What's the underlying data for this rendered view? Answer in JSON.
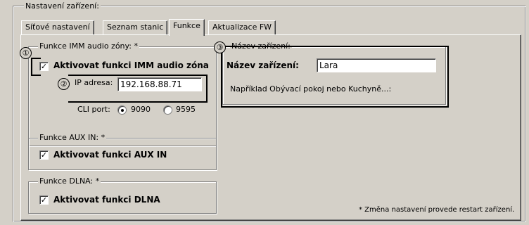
{
  "window": {
    "group_title": "Nastavení zařízení:"
  },
  "tabs": [
    {
      "label": "Síťové nastavení"
    },
    {
      "label": "Seznam stanic"
    },
    {
      "label": "Funkce"
    },
    {
      "label": "Aktualizace FW"
    }
  ],
  "imm": {
    "legend": "Funkce IMM audio zóny: *",
    "checkbox_label": "Aktivovat funkci IMM audio zóna",
    "checked": true,
    "ip_label": "IP adresa:",
    "ip_value": "192.168.88.71",
    "cli_label": "CLI port:",
    "cli_options": [
      "9090",
      "9595"
    ],
    "cli_selected": "9090"
  },
  "aux": {
    "legend": "Funkce AUX IN: *",
    "checkbox_label": "Aktivovat funkci AUX IN",
    "checked": true
  },
  "dlna": {
    "legend": "Funkce DLNA: *",
    "checkbox_label": "Aktivovat funkci DLNA",
    "checked": true
  },
  "device": {
    "legend": "Název zařízení:",
    "name_label": "Název zařízení:",
    "name_value": "Lara",
    "hint": "Například Obývací pokoj nebo Kuchyně...:"
  },
  "footnote": "* Změna nastavení provede restart zařízení.",
  "markers": [
    "①",
    "②",
    "③"
  ],
  "check_glyph": "✓"
}
